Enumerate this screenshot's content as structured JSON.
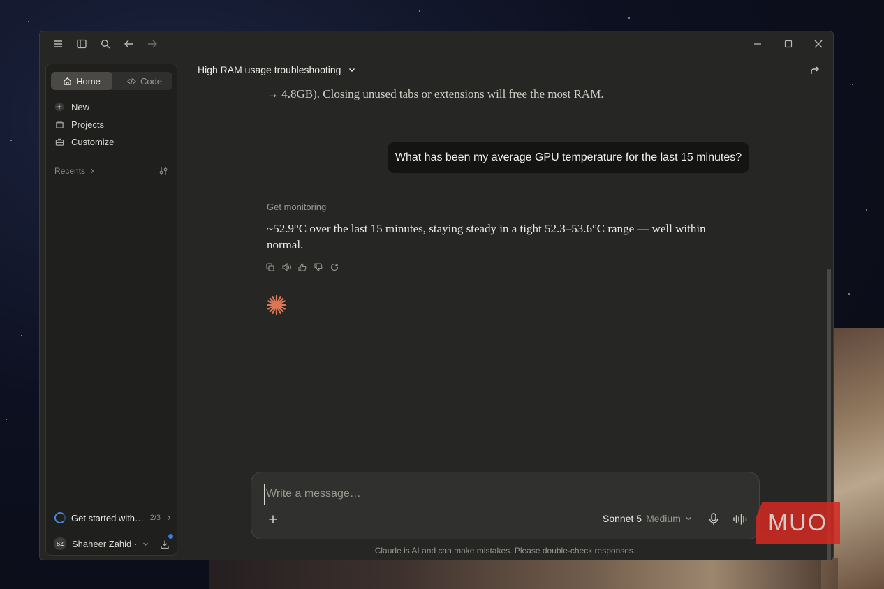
{
  "window": {
    "controls": [
      "menu-icon",
      "sidebar-toggle-icon",
      "search-icon",
      "back-icon",
      "forward-icon",
      "minimize-icon",
      "maximize-icon",
      "close-icon"
    ]
  },
  "sidebar": {
    "segments": {
      "home": "Home",
      "code": "Code"
    },
    "items": [
      {
        "label": "New",
        "icon": "plus-icon"
      },
      {
        "label": "Projects",
        "icon": "folder-icon"
      },
      {
        "label": "Customize",
        "icon": "briefcase-icon"
      }
    ],
    "recents_label": "Recents",
    "get_started": {
      "label": "Get started with…",
      "count": "2/3"
    },
    "user": {
      "initials": "SZ",
      "name": "Shaheer Zahid ·"
    }
  },
  "header": {
    "title": "High RAM usage troubleshooting"
  },
  "conversation": {
    "prev_fragment": "→ 4.8GB). Closing unused tabs or extensions will free the most RAM.",
    "user_message": "What has been my average GPU temperature for the last 15 minutes?",
    "tool_label": "Get monitoring",
    "assistant_reply": "~52.9°C over the last 15 minutes, staying steady in a tight 52.3–53.6°C range — well within normal."
  },
  "composer": {
    "placeholder": "Write a message…",
    "model": "Sonnet 5",
    "effort": "Medium"
  },
  "disclaimer": "Claude is AI and can make mistakes. Please double-check responses.",
  "watermark": "MUO",
  "colors": {
    "accent_spark": "#d97757",
    "watermark_red": "#d42a22",
    "progress_blue": "#4a86d8"
  }
}
